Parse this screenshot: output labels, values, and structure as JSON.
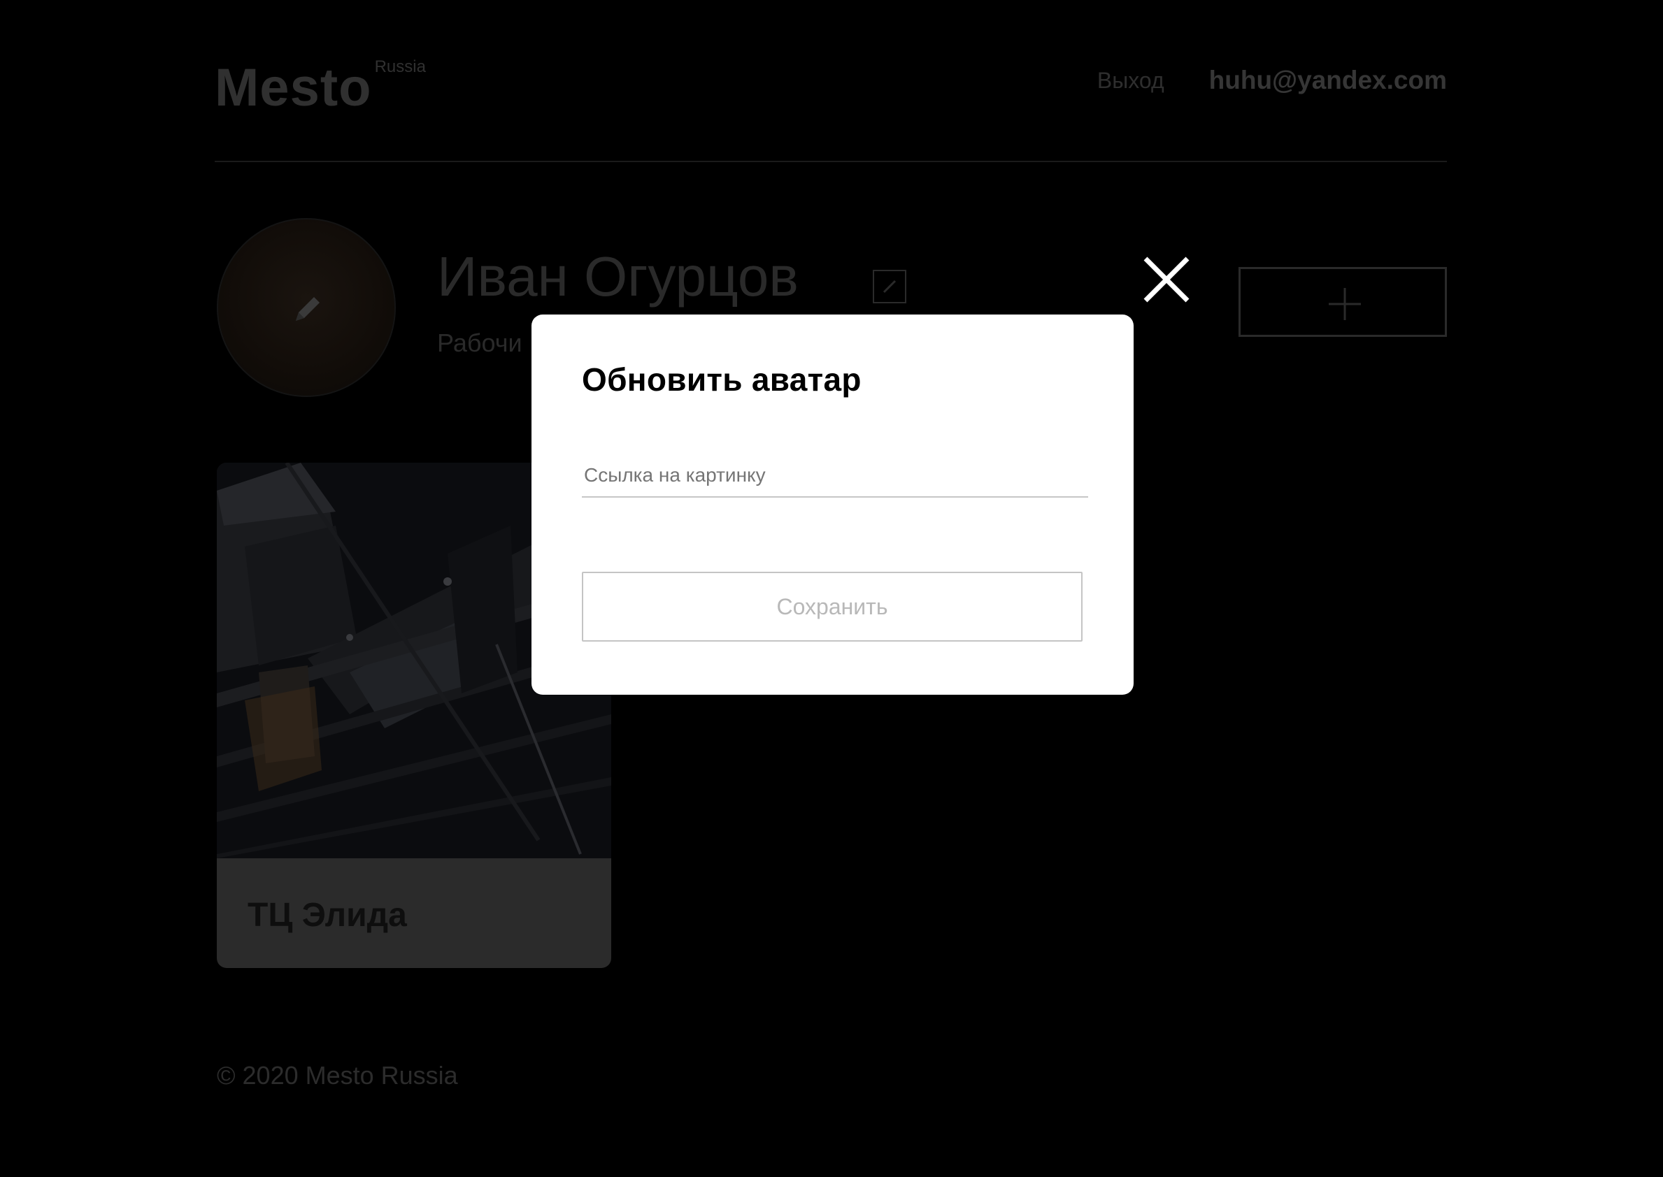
{
  "header": {
    "logo": "Mesto",
    "logo_sub": "Russia",
    "logout_label": "Выход",
    "user_email": "huhu@yandex.com"
  },
  "profile": {
    "name": "Иван Огурцов",
    "about": "Рабочи",
    "avatar_icon": "pencil-icon",
    "edit_icon": "pencil-icon",
    "add_icon": "plus-icon"
  },
  "cards": [
    {
      "title": "ТЦ Элида"
    }
  ],
  "footer": {
    "copyright": "© 2020 Mesto Russia"
  },
  "popup": {
    "title": "Обновить аватар",
    "input_placeholder": "Ссылка на картинку",
    "input_value": "",
    "save_label": "Сохранить",
    "close_icon": "close-icon"
  },
  "colors": {
    "page_background": "#000000",
    "popup_background": "#ffffff",
    "dimmed_text": "#2a2a2a",
    "disabled_button_text": "#b8b8b8"
  }
}
